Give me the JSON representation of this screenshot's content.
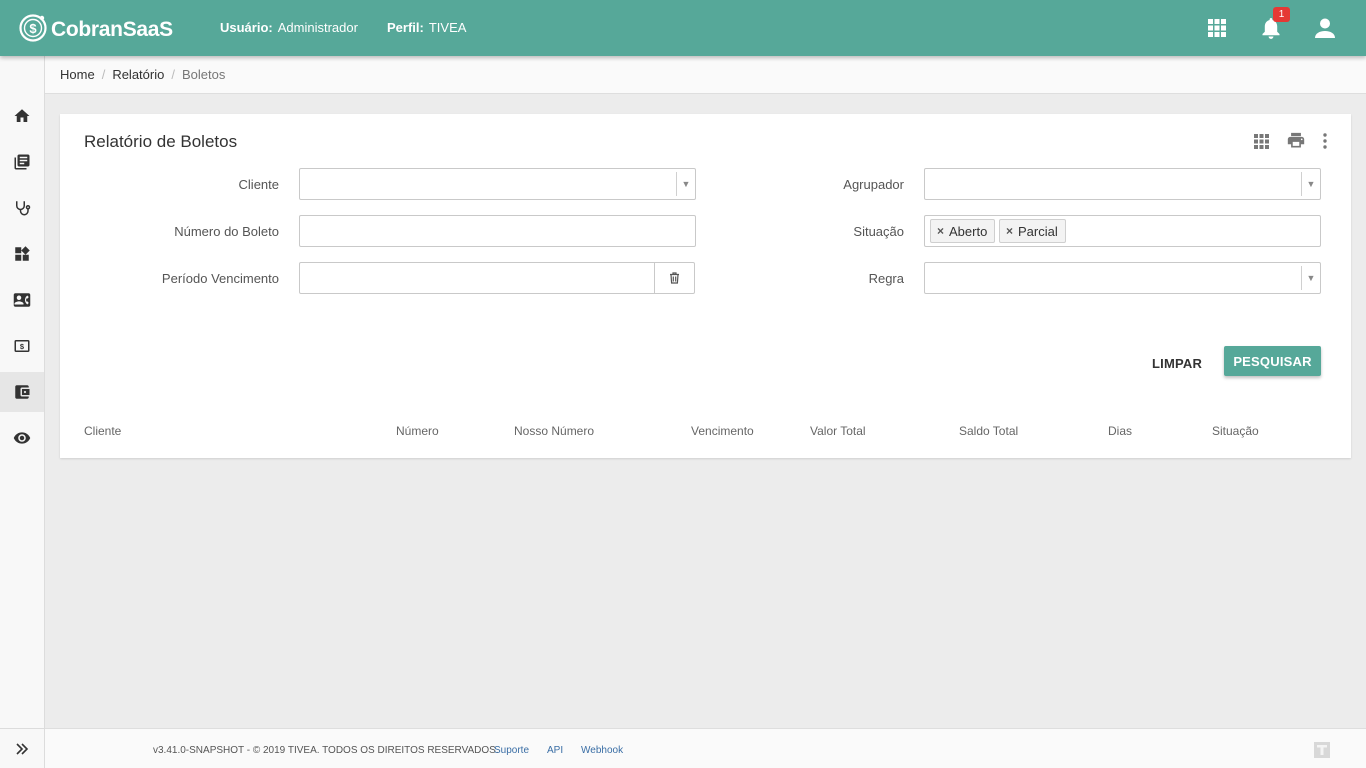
{
  "header": {
    "brand": "CobranSaaS",
    "user_label": "Usuário:",
    "user_value": "Administrador",
    "profile_label": "Perfil:",
    "profile_value": "TIVEA",
    "notification_count": "1",
    "icons": [
      "apps-icon",
      "bell-icon",
      "account-icon"
    ],
    "color": "#56a899"
  },
  "sidebar": {
    "items": [
      {
        "icon": "home-icon"
      },
      {
        "icon": "library-icon"
      },
      {
        "icon": "stethoscope-icon"
      },
      {
        "icon": "dashboard-widgets-icon"
      },
      {
        "icon": "contact-card-icon"
      },
      {
        "icon": "money-icon"
      },
      {
        "icon": "wallet-icon",
        "active": true
      },
      {
        "icon": "eye-icon"
      }
    ],
    "toggle_icon": "double-chevron-right-icon"
  },
  "breadcrumb": [
    "Home",
    "Relatório",
    "Boletos"
  ],
  "card": {
    "title": "Relatório de Boletos",
    "tools": [
      "grid-icon",
      "print-icon",
      "more-vert-icon"
    ]
  },
  "form": {
    "cliente_label": "Cliente",
    "cliente_value": "",
    "numero_label": "Número do Boleto",
    "numero_value": "",
    "periodo_label": "Período Vencimento",
    "periodo_value": "",
    "agrupador_label": "Agrupador",
    "agrupador_value": "",
    "situacao_label": "Situação",
    "situacao_chips": [
      "Aberto",
      "Parcial"
    ],
    "chip_remove": "×",
    "regra_label": "Regra",
    "regra_value": ""
  },
  "actions": {
    "clear": "LIMPAR",
    "search": "PESQUISAR"
  },
  "table": {
    "columns": [
      "Cliente",
      "Número",
      "Nosso Número",
      "Vencimento",
      "Valor Total",
      "Saldo Total",
      "Dias",
      "Situação"
    ]
  },
  "footer": {
    "copyright": "v3.41.0-SNAPSHOT - © 2019 TIVEA. TODOS OS DIREITOS RESERVADOS.",
    "links": [
      "Suporte",
      "API",
      "Webhook"
    ]
  }
}
